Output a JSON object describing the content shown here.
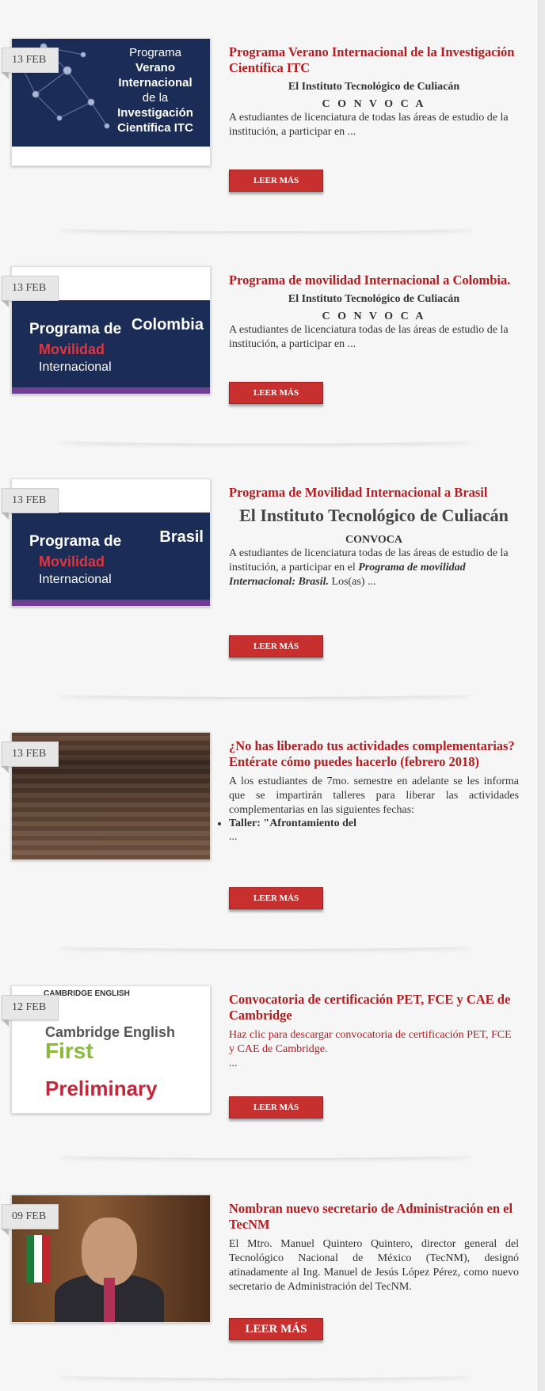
{
  "posts": [
    {
      "date": "13 FEB",
      "title": "Programa Verano Internacional de la Investigación Científica ITC",
      "org": "El Instituto Tecnológico de Culiacán",
      "convoca": "C O N V O C A",
      "excerpt": "A estudiantes de licenciatura de todas las áreas de estudio de la institución, a participar en ...",
      "button": "LEER MÁS",
      "thumb_text": [
        "Programa",
        "Verano",
        "Internacional",
        "de la",
        "Investigación",
        "Científica ITC"
      ]
    },
    {
      "date": "13 FEB",
      "title": "Programa de movilidad Internacional a Colombia.",
      "org": "El Instituto Tecnológico de Culiacán",
      "convoca": "C O N V O C A",
      "excerpt": "A estudiantes de licenciatura todas de las áreas de estudio de la institución, a participar en ...",
      "button": "LEER MÁS",
      "thumb_text": [
        "Programa de",
        "Movilidad",
        "Internacional",
        "Colombia"
      ]
    },
    {
      "date": "13 FEB",
      "title": "Programa de Movilidad Internacional a Brasil",
      "org": "El Instituto Tecnológico de Culiacán",
      "convoca": "CONVOCA",
      "excerpt_pre": "A estudiantes de licenciatura todas de las áreas de estudio de la institución, a participar en el ",
      "excerpt_em": "Programa de movilidad Internacional: Brasil.",
      "excerpt_post": " Los(as) ...",
      "button": "LEER MÁS",
      "thumb_text": [
        "Programa de",
        "Movilidad",
        "Internacional",
        "Brasil"
      ]
    },
    {
      "date": "13 FEB",
      "title": "¿No has liberado tus actividades complementarias? Entérate cómo puedes hacerlo (febrero 2018)",
      "excerpt": "A los estudiantes de 7mo. semestre en adelante se les informa que se impartirán talleres para liberar las actividades complementarias en las siguientes fechas:",
      "bullet": "Taller: \"Afrontamiento del",
      "ellipsis": "...",
      "button": "LEER MÁS"
    },
    {
      "date": "12 FEB",
      "title": "Convocatoria de certificación PET, FCE y CAE de Cambridge",
      "excerpt": "Haz clic para descargar convocatoria de certificación PET, FCE y CAE de Cambridge.",
      "ellipsis": "...",
      "button": "LEER MÁS",
      "thumb_text": [
        "CAMBRIDGE ENGLISH",
        "Cambridge English",
        "First",
        "Preliminary"
      ]
    },
    {
      "date": "09 FEB",
      "title": "Nombran nuevo secretario de Administración en el TecNM",
      "excerpt": "El Mtro. Manuel Quintero Quintero, director general del Tecnológico Nacional de México (TecNM), designó atinadamente al Ing. Manuel de Jesús López Pérez, como nuevo secretario de Administración del TecNM.",
      "button": "LEER MÁS"
    }
  ],
  "colors": {
    "accent": "#b01e22",
    "button": "#c8302f",
    "navy": "#1b2c56"
  }
}
